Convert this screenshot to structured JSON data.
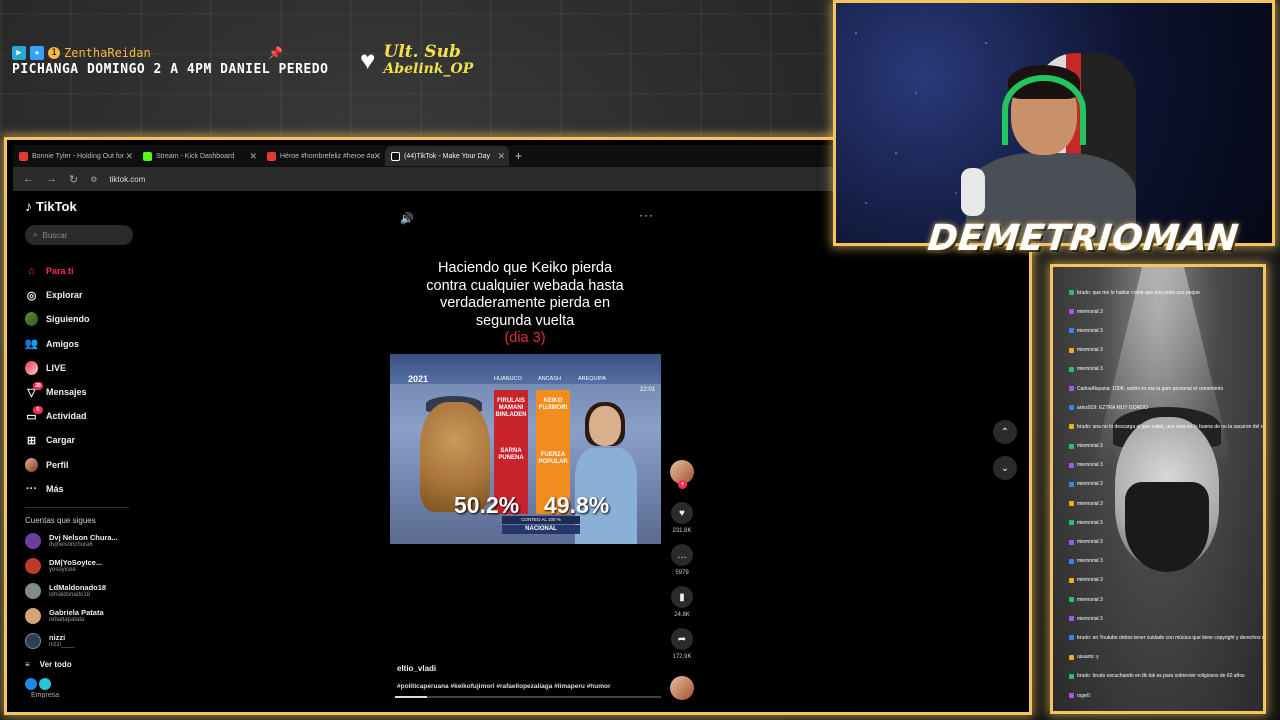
{
  "overlay": {
    "user_name": "ZenthaReidan",
    "badge_count": "1",
    "announcement": "PICHANGA DOMINGO 2 A 4PM DANIEL PEREDO",
    "last_sub_title": "Ult. Sub",
    "last_sub_name": "Abelink_OP",
    "streamer": "DEMETRIOMAN"
  },
  "browser": {
    "tabs": [
      {
        "label": "Bonnie Tyler - Holding Out for",
        "color": "#e53935"
      },
      {
        "label": "Stream - Kick Dashboard",
        "color": "#53fc18"
      },
      {
        "label": "Héroe #hombrefeliz #heroe #a",
        "color": "#e53935"
      },
      {
        "label": "(44)TikTok - Make Your Day",
        "color": "#ffffff"
      }
    ],
    "url": "tiktok.com"
  },
  "tiktok": {
    "brand": "TikTok",
    "search_placeholder": "Buscar",
    "menu": [
      {
        "label": "Para ti",
        "icon": "home-icon",
        "active": true
      },
      {
        "label": "Explorar",
        "icon": "compass-icon"
      },
      {
        "label": "Siguiendo",
        "icon": "following-icon"
      },
      {
        "label": "Amigos",
        "icon": "friends-icon"
      },
      {
        "label": "LIVE",
        "icon": "live-icon"
      },
      {
        "label": "Mensajes",
        "icon": "messages-icon",
        "badge": "38"
      },
      {
        "label": "Actividad",
        "icon": "activity-icon",
        "badge": "6"
      },
      {
        "label": "Cargar",
        "icon": "upload-icon"
      },
      {
        "label": "Perfil",
        "icon": "profile-icon"
      },
      {
        "label": "Más",
        "icon": "more-icon"
      }
    ],
    "following_title": "Cuentas que sigues",
    "following": [
      {
        "name": "Dvj Nelson Chura...",
        "handle": "dvjnelsonchura6",
        "color": "#6a3fa0"
      },
      {
        "name": "DM|YoSoyIce...",
        "handle": "yosoyicee",
        "color": "#c0392b"
      },
      {
        "name": "LdMaldonado18",
        "handle": "ldmaldonado18",
        "color": "#7f8c8d"
      },
      {
        "name": "Gabriela Patata",
        "handle": "rebattapatata",
        "color": "#d4a574"
      },
      {
        "name": "nizzi",
        "handle": "nizzi____",
        "color": "#2c3e50"
      }
    ],
    "see_all": "Ver todo",
    "business": "Empresa",
    "video": {
      "caption_lines": [
        "Haciendo que Keiko pierda",
        "contra cualquier webada hasta",
        "verdaderamente pierda en",
        "segunda vuelta"
      ],
      "caption_day": "(dia 3)",
      "thumb": {
        "year": "2021",
        "regions": [
          "HUANUCO",
          "ANCASH",
          "AREQUIPA"
        ],
        "time": "22:01",
        "bar1_top": "FIRULAIS MAMANI BINLADEN",
        "bar1_bottom": "SARNA PUNENA",
        "bar2_top": "KEIKO FUJIMORI",
        "bar2_bottom": "FUERZA POPULAR",
        "pct1": "50.2%",
        "pct2": "49.8%",
        "count": "CONTEO AL 100 %",
        "scope": "NACIONAL"
      },
      "creator": "eltio_vladi",
      "hashtags": "#politicaperuana #keikofujimori #rafaellopezaliaga #limaperu #humor",
      "likes": "231.8K",
      "comments": "5979",
      "saves": "24.8K",
      "shares": "172.9K",
      "progress": 0.12
    }
  },
  "chat": {
    "messages": [
      {
        "user": "",
        "text": "brudo: que me lo hablar coma que era vuelo uso peque"
      },
      {
        "user": "",
        "text": "miemorial 3"
      },
      {
        "user": "",
        "text": "miemorial 3"
      },
      {
        "user": "",
        "text": "miemorial 3"
      },
      {
        "user": "",
        "text": "miemorial 3"
      },
      {
        "user": "",
        "text": "CarlosAlayana: 100K: unlimi es ma la gam personal el cementerio"
      },
      {
        "user": "",
        "text": "ariez919: EZTRA MUY GORDO"
      },
      {
        "user": "",
        "text": "brudo: una no lo descarga el que subió, uno esta en lo buena de no la sacaron del resultado"
      },
      {
        "user": "",
        "text": "miemorial 3"
      },
      {
        "user": "",
        "text": "miemorial 3"
      },
      {
        "user": "",
        "text": "miemorial 3"
      },
      {
        "user": "",
        "text": "miemorial 3"
      },
      {
        "user": "",
        "text": "miemorial 3"
      },
      {
        "user": "",
        "text": "miemorial 3"
      },
      {
        "user": "",
        "text": "miemorial 3"
      },
      {
        "user": "",
        "text": "miemorial 3"
      },
      {
        "user": "",
        "text": "miemorial 3"
      },
      {
        "user": "",
        "text": "miemorial 3"
      },
      {
        "user": "",
        "text": "brudo: en Youtube debes tener cuidado con música que tiene copyright y derechos de autor, y pues, sólo te"
      },
      {
        "user": "",
        "text": "usuario: y"
      },
      {
        "user": "",
        "text": "brudo: brudo escuchando en tik tok es para sobrevivir religiosos de 60 años"
      },
      {
        "user": "",
        "text": "rsge0:"
      }
    ]
  },
  "colors": {
    "frame": "#f3c460",
    "tiktok_accent": "#fe2c55"
  }
}
